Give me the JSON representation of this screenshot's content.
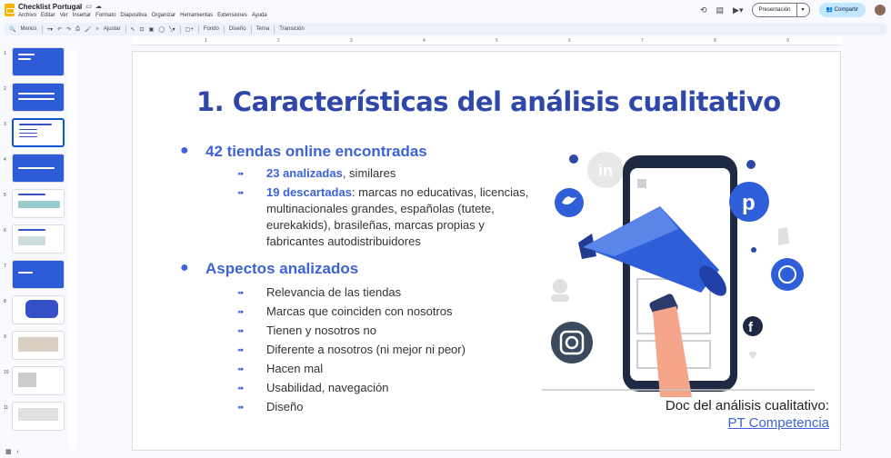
{
  "app": {
    "doc_title": "Checklist Portugal",
    "menu": [
      "Archivo",
      "Editar",
      "Ver",
      "Insertar",
      "Formato",
      "Diapositiva",
      "Organizar",
      "Herramientas",
      "Extensiones",
      "Ayuda"
    ],
    "present_label": "Presentación",
    "share_label": "Compartir"
  },
  "toolbar": {
    "search_label": "Menús",
    "zoom_label": "Ajustar",
    "fondo": "Fondo",
    "diseno": "Diseño",
    "tema": "Tema",
    "transicion": "Transición"
  },
  "ruler": [
    "1",
    "2",
    "3",
    "4",
    "5",
    "6",
    "7",
    "8",
    "9"
  ],
  "filmstrip": [
    "1",
    "2",
    "3",
    "4",
    "5",
    "6",
    "7",
    "8",
    "9",
    "10",
    "11"
  ],
  "slide": {
    "title": "1. Características del análisis cualitativo",
    "section1": {
      "heading": "42 tiendas online encontradas",
      "items": [
        {
          "bold": "23 analizadas",
          "rest": ", similares"
        },
        {
          "bold": "19 descartadas",
          "rest": ": marcas no educativas, licencias, multinacionales grandes, españolas (tutete, eurekakids), brasileñas, marcas propias y fabricantes autodistribuidores"
        }
      ]
    },
    "section2": {
      "heading": "Aspectos analizados",
      "items": [
        "Relevancia de las tiendas",
        "Marcas que coinciden con nosotros",
        "Tienen y nosotros no",
        "Diferente a nosotros (ni mejor ni peor)",
        "Hacen mal",
        "Usabilidad, navegación",
        "Diseño"
      ]
    },
    "doc_label": "Doc del análisis cualitativo:",
    "doc_link": "PT Competencia"
  },
  "colors": {
    "accent": "#3d63d6",
    "title": "#2f47a6",
    "share_bg": "#c2e7ff"
  }
}
